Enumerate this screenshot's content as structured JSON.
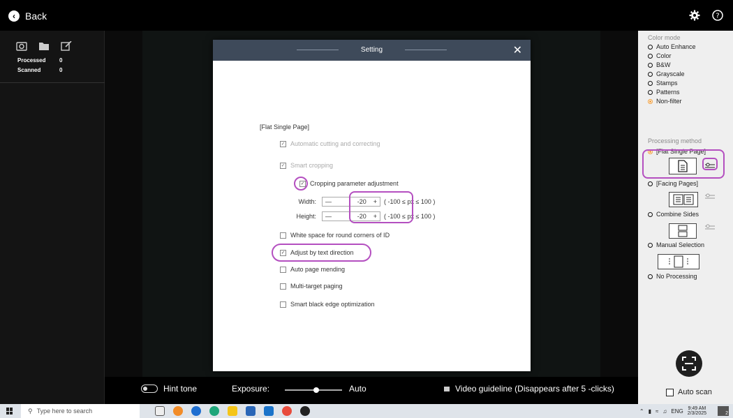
{
  "header": {
    "back_label": "Back",
    "settings_icon": "gear-icon",
    "help_icon": "help-icon"
  },
  "left_panel": {
    "processed_label": "Processed",
    "processed_value": "0",
    "scanned_label": "Scanned",
    "scanned_value": "0"
  },
  "dialog": {
    "title": "Setting",
    "section_label": "[Flat Single Page]",
    "items": {
      "auto_cut": "Automatic cutting and correcting",
      "smart_crop": "Smart cropping",
      "crop_param": "Cropping parameter adjustment",
      "width_label": "Width:",
      "width_value": "-20",
      "height_label": "Height:",
      "height_value": "-20",
      "range": "( -100 ≤ px ≤ 100 )",
      "white_space": "White space for round corners of ID",
      "text_dir": "Adjust by text direction",
      "mending": "Auto page mending",
      "multi_target": "Multi-target paging",
      "black_edge": "Smart black edge optimization"
    },
    "minus": "—",
    "plus": "+"
  },
  "right_panel": {
    "color_mode_title": "Color mode",
    "color_modes": [
      "Auto Enhance",
      "Color",
      "B&W",
      "Grayscale",
      "Stamps",
      "Patterns",
      "Non-filter"
    ],
    "selected_color_mode": "Non-filter",
    "processing_title": "Processing method",
    "methods": [
      "[Flat Single Page]",
      "[Facing Pages]",
      "Combine Sides",
      "Manual Selection",
      "No Processing"
    ],
    "selected_method": "[Flat Single Page]",
    "auto_scan_label": "Auto scan"
  },
  "bottombar": {
    "hint_tone": "Hint tone",
    "exposure_label": "Exposure:",
    "exposure_level": 0.55,
    "exposure_mode": "Auto",
    "video_guideline": "Video guideline  (Disappears after 5 -clicks)"
  },
  "taskbar": {
    "search_placeholder": "Type here to search",
    "lang": "ENG",
    "time": "9:49 AM",
    "date": "2/3/2025",
    "notif_count": "2"
  },
  "colors": {
    "highlight": "#b44fc0",
    "selected_radio": "#f0a040",
    "dialog_header": "#3e4a5a"
  }
}
